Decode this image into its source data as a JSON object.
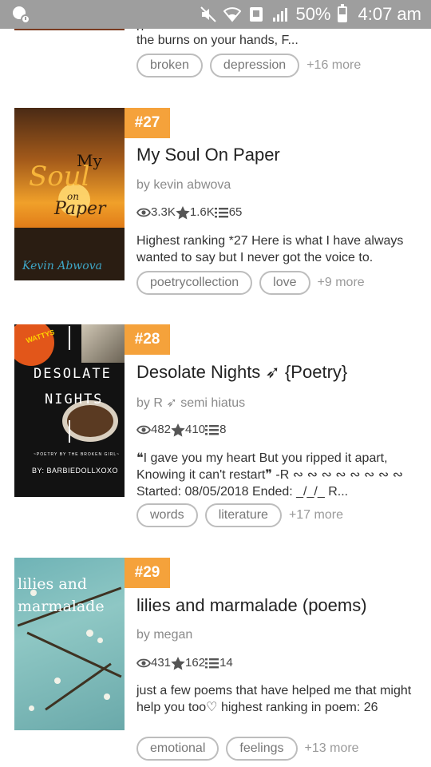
{
  "status_bar": {
    "battery_percent": "50%",
    "time": "4:07 am",
    "battery_level": 0.5,
    "icons": [
      "notification-icon",
      "mute-icon",
      "wifi-icon",
      "nfc-icon",
      "signal-icon",
      "battery-icon"
    ]
  },
  "partial_story": {
    "desc_tail": "the burns on your hands, F...",
    "tags": [
      "broken",
      "depression"
    ],
    "more": "+16 more"
  },
  "stories": [
    {
      "rank": "#27",
      "title": "My Soul On Paper",
      "author": "by kevin abwova",
      "reads": "3.3K",
      "votes": "1.6K",
      "parts": "65",
      "description": "Highest ranking *27 Here is what I have always wanted to say but I never got the voice to.",
      "tags": [
        "poetrycollection",
        "love"
      ],
      "more": "+9 more",
      "cover": {
        "line1": "My",
        "line2": "Soul",
        "line3": "on",
        "line4": "Paper",
        "author": "Kevin Abwova"
      }
    },
    {
      "rank": "#28",
      "title": "Desolate Nights ➶ {Poetry}",
      "author": "by R ➶ semi hiatus",
      "reads": "482",
      "votes": "410",
      "parts": "8",
      "description": "❝I gave you my heart But you ripped it apart, Knowing it can't restart❞ -R ∾ ∾ ∾ ∾ ∾ ∾ ∾ ∾ Started: 08/05/2018 Ended: _/_/_ R...",
      "tags": [
        "words",
        "literature"
      ],
      "more": "+17 more",
      "cover": {
        "line1": "DESOLATE",
        "line2": "NIGHTS",
        "small": "~POETRY BY THE BROKEN GIRL~",
        "author": "BY: BARBIEDOLLXOXO"
      }
    },
    {
      "rank": "#29",
      "title": "lilies and marmalade (poems)",
      "author": "by megan",
      "reads": "431",
      "votes": "162",
      "parts": "14",
      "description": "just a few poems that have helped me that might help you too♡ highest ranking in poem: 26",
      "tags": [
        "emotional",
        "feelings"
      ],
      "more": "+13 more",
      "cover": {
        "line1": "lilies and",
        "line2": "marmalade"
      }
    }
  ]
}
